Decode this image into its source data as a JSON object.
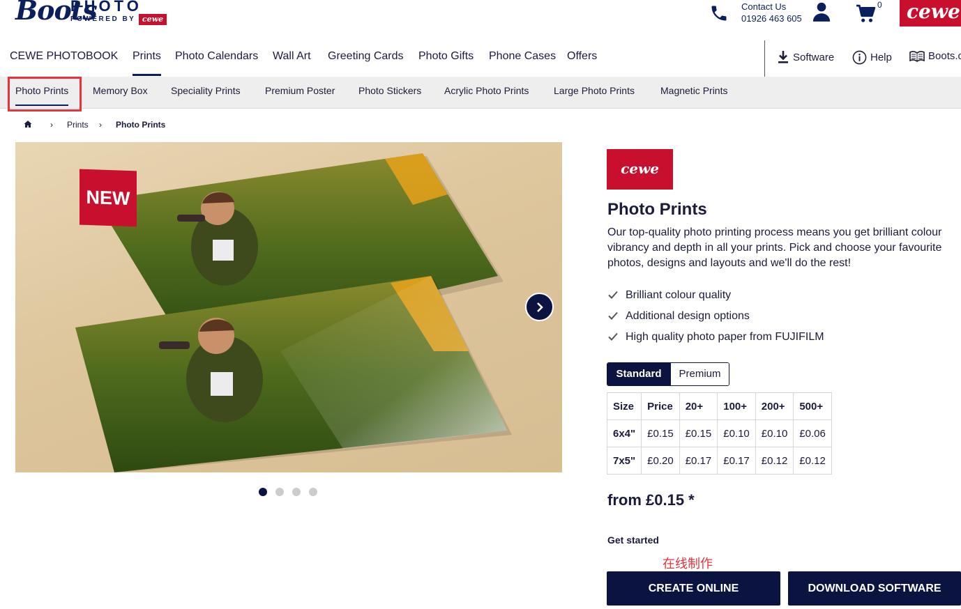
{
  "header": {
    "logo_boots": "Boots",
    "logo_photo": "PHOTO",
    "logo_powered": "POWERED BY",
    "logo_cewe": "cewe",
    "contact_label": "Contact Us",
    "contact_number": "01926 463 605",
    "cart_count": "0",
    "cewe_corner": "cewe",
    "icons": [
      "phone-icon",
      "user-icon",
      "cart-icon"
    ]
  },
  "main_nav": {
    "items": [
      "CEWE PHOTOBOOK",
      "Prints",
      "Photo Calendars",
      "Wall Art",
      "Greeting Cards",
      "Photo Gifts",
      "Phone Cases",
      "Offers"
    ],
    "active": "Prints",
    "utilities": {
      "software": "Software",
      "help": "Help",
      "boots": "Boots.c"
    }
  },
  "sub_nav": {
    "items": [
      "Photo Prints",
      "Memory Box",
      "Speciality Prints",
      "Premium Poster",
      "Photo Stickers",
      "Acrylic Photo Prints",
      "Large Photo Prints",
      "Magnetic Prints"
    ],
    "active": "Photo Prints"
  },
  "breadcrumb": {
    "home_icon": "home-icon",
    "separator": "›",
    "items": [
      "Prints",
      "Photo Prints"
    ]
  },
  "hero": {
    "badge": "NEW",
    "slides_total": 4,
    "active_slide": 1
  },
  "product": {
    "brand_logo": "cewe",
    "title": "Photo Prints",
    "description": "Our top-quality photo printing process means you get brilliant colour vibrancy and depth in all your prints. Pick and choose your favourite photos, designs and layouts and we'll do the rest!",
    "features": [
      "Brilliant colour quality",
      "Additional design options",
      "High quality photo paper from FUJIFILM"
    ],
    "toggle": {
      "standard": "Standard",
      "premium": "Premium",
      "selected": "Standard"
    },
    "table": {
      "headers": [
        "Size",
        "Price",
        "20+",
        "100+",
        "200+",
        "500+"
      ],
      "rows": [
        [
          "6x4\"",
          "£0.15",
          "£0.15",
          "£0.10",
          "£0.10",
          "£0.06"
        ],
        [
          "7x5\"",
          "£0.20",
          "£0.17",
          "£0.17",
          "£0.12",
          "£0.12"
        ]
      ]
    },
    "from_price": "from £0.15 *",
    "get_started": "Get started",
    "annotation": "在线制作",
    "create_online": "CREATE ONLINE",
    "download_software": "DOWNLOAD SOFTWARE"
  },
  "colors": {
    "brand_navy": "#0b1440",
    "cewe_red": "#c8102e",
    "highlight_red": "#e8333a",
    "subnav_bg": "#eeeeee"
  }
}
